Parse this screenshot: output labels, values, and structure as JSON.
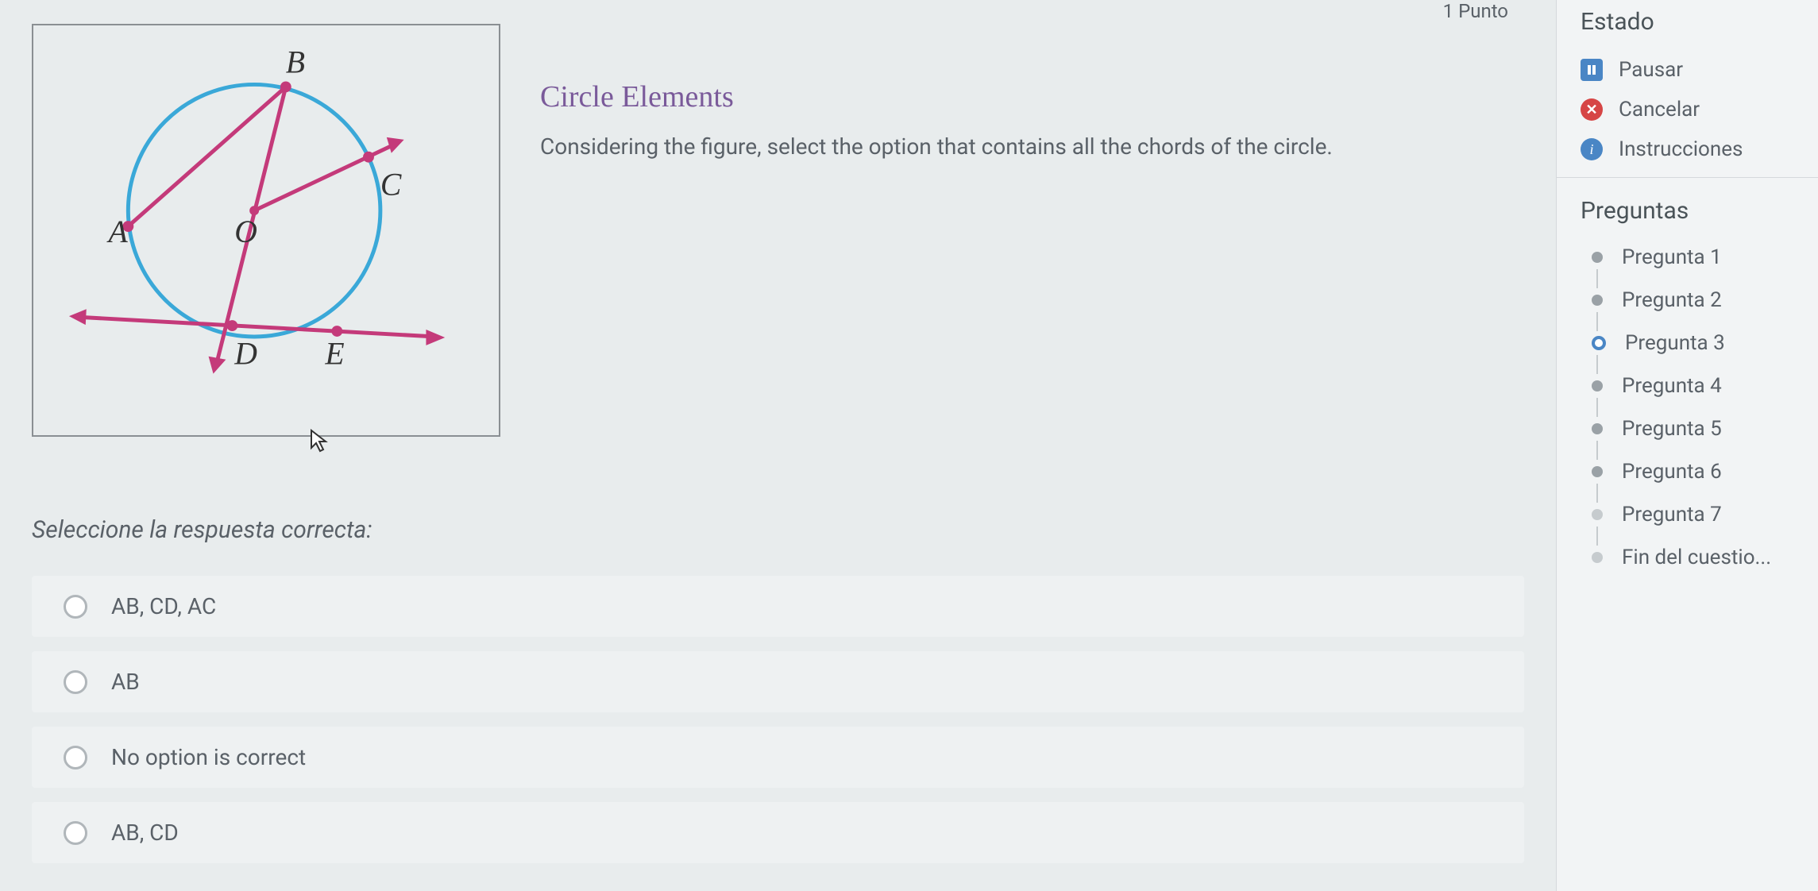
{
  "header": {
    "points": "1 Punto"
  },
  "question": {
    "title": "Circle Elements",
    "prompt": "Considering the figure, select the option that contains all the chords of the circle.",
    "instruction": "Seleccione la respuesta correcta:"
  },
  "figure": {
    "labels": {
      "A": "A",
      "B": "B",
      "C": "C",
      "D": "D",
      "E": "E",
      "O": "O"
    }
  },
  "options": [
    {
      "label": "AB, CD, AC"
    },
    {
      "label": "AB"
    },
    {
      "label": "No option is correct"
    },
    {
      "label": "AB, CD"
    }
  ],
  "sidebar": {
    "estado_title": "Estado",
    "pausar": "Pausar",
    "cancelar": "Cancelar",
    "instrucciones": "Instrucciones",
    "preguntas_title": "Preguntas",
    "items": [
      {
        "label": "Pregunta 1",
        "state": "dot"
      },
      {
        "label": "Pregunta 2",
        "state": "dot"
      },
      {
        "label": "Pregunta 3",
        "state": "current"
      },
      {
        "label": "Pregunta 4",
        "state": "dot"
      },
      {
        "label": "Pregunta 5",
        "state": "dot"
      },
      {
        "label": "Pregunta 6",
        "state": "dot"
      },
      {
        "label": "Pregunta 7",
        "state": "faded"
      },
      {
        "label": "Fin del cuestio...",
        "state": "faded"
      }
    ]
  }
}
